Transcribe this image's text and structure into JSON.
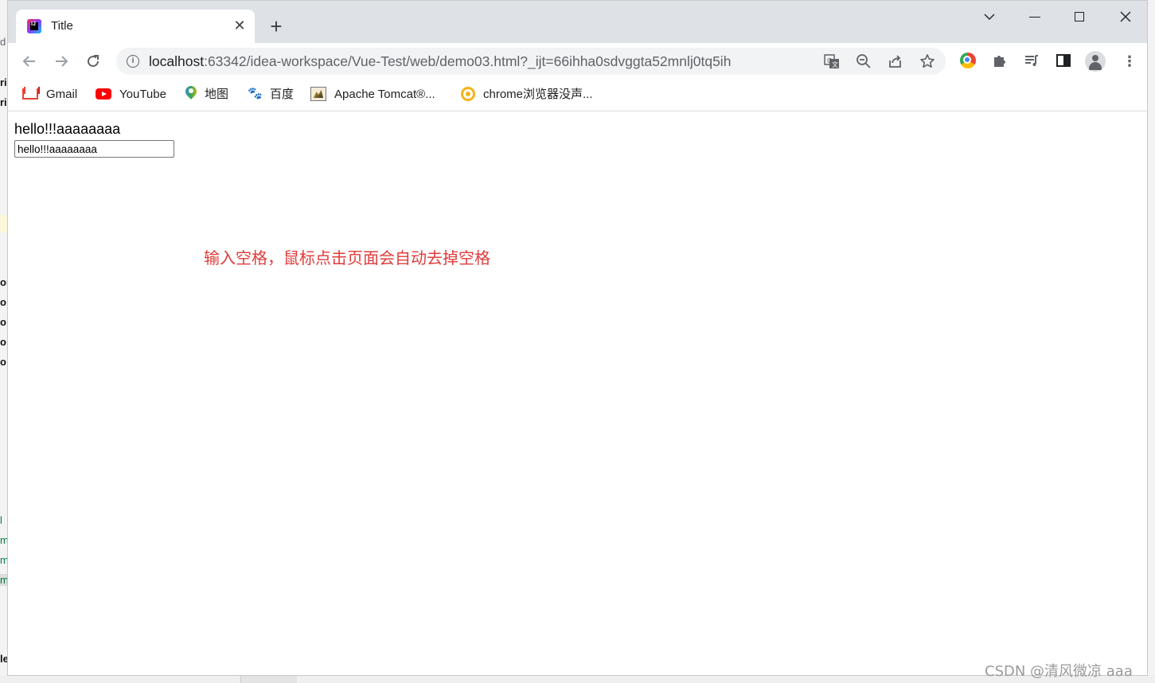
{
  "background_ide": {
    "left_fragments": [
      "d",
      "ri",
      "ri",
      "or",
      "o",
      "o",
      "o",
      "o",
      "l",
      "m",
      "m",
      "m",
      "le"
    ]
  },
  "browser": {
    "tab": {
      "title": "Title",
      "favicon": "intellij-icon",
      "close_icon": "close-icon"
    },
    "new_tab_icon": "plus-icon",
    "window_controls": [
      "chevron-down-icon",
      "minimize-icon",
      "maximize-icon",
      "close-icon"
    ],
    "toolbar": {
      "back_icon": "arrow-left-icon",
      "forward_icon": "arrow-right-icon",
      "reload_icon": "reload-icon",
      "url_host": "localhost",
      "url_rest": ":63342/idea-workspace/Vue-Test/web/demo03.html?_ijt=66ihha0sdvggta52mnlj0tq5ih",
      "omnibox_icons": [
        "translate-icon",
        "zoom-out-icon",
        "share-icon",
        "star-icon"
      ],
      "right_icons": [
        "chrome-extension-icon",
        "puzzle-icon",
        "media-playlist-icon",
        "side-panel-icon",
        "profile-avatar-icon",
        "kebab-menu-icon"
      ]
    },
    "bookmarks": [
      {
        "label": "Gmail",
        "icon": "gmail-icon"
      },
      {
        "label": "YouTube",
        "icon": "youtube-icon"
      },
      {
        "label": "地图",
        "icon": "maps-icon"
      },
      {
        "label": "百度",
        "icon": "baidu-icon"
      },
      {
        "label": "Apache Tomcat®...",
        "icon": "tomcat-icon"
      },
      {
        "label": "chrome浏览器没声...",
        "icon": "chrome-help-icon"
      }
    ]
  },
  "page": {
    "message": "hello!!!aaaaaaaa",
    "input_value": "hello!!!aaaaaaaa",
    "annotation": "输入空格，鼠标点击页面会自动去掉空格",
    "annotation_color": "#e03b3b"
  },
  "watermark": "CSDN @清风微凉 aaa"
}
